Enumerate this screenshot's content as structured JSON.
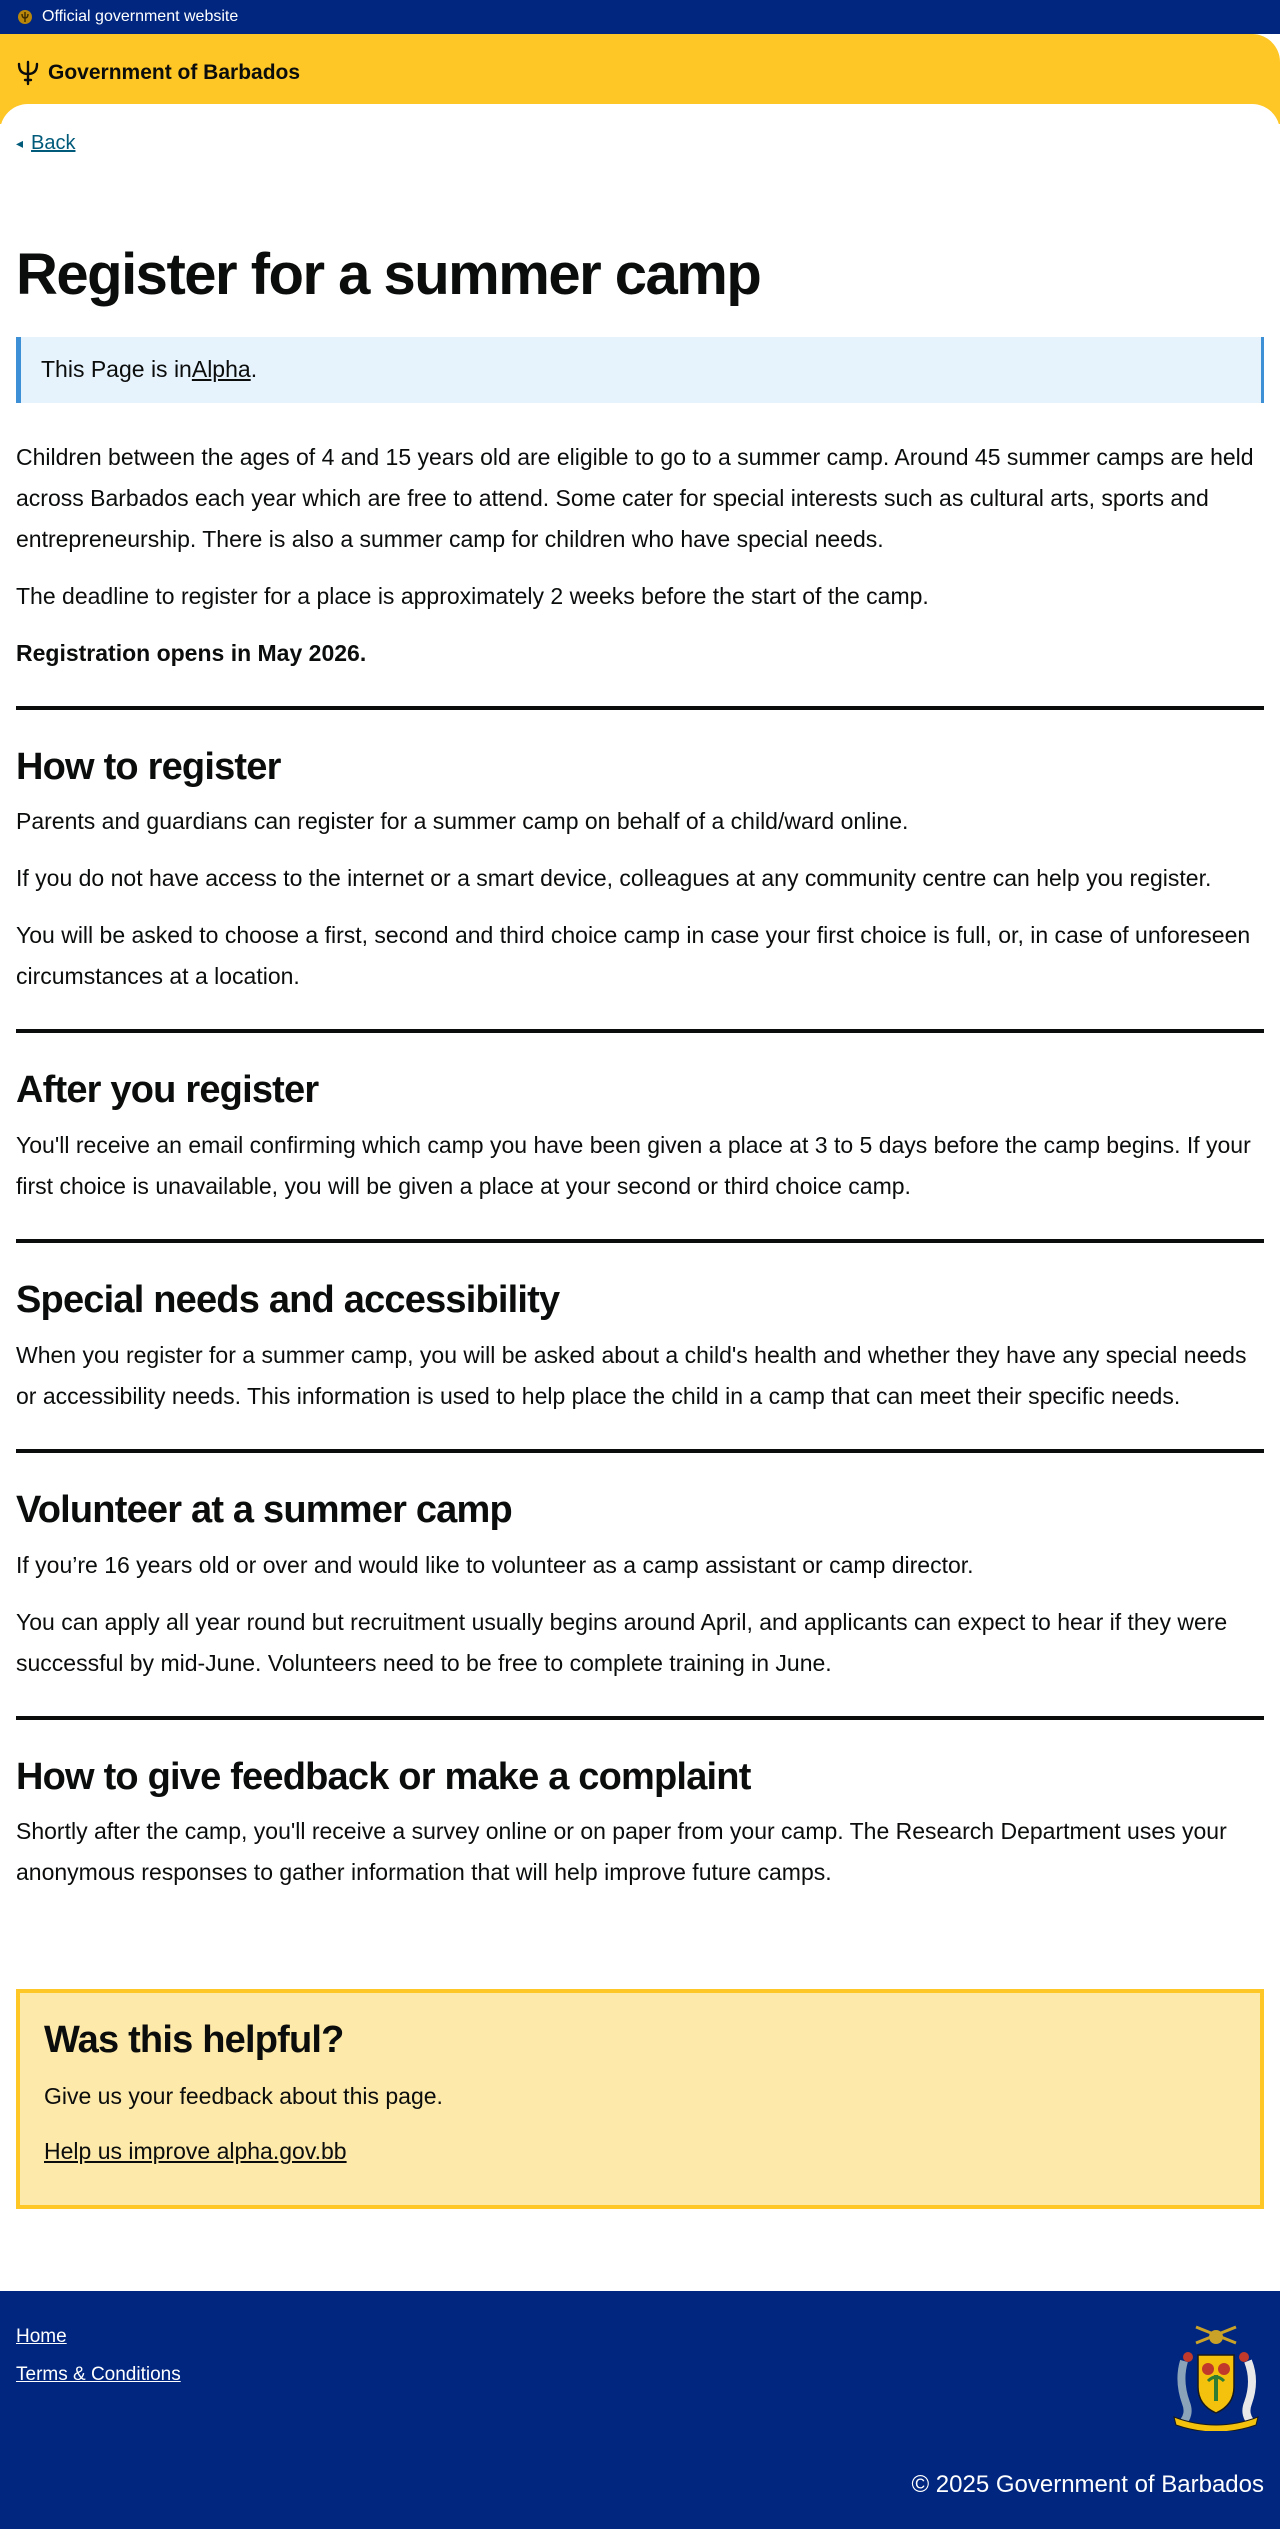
{
  "topbar": {
    "label": "Official government website",
    "flag_icon": "barbados-flag-icon"
  },
  "header": {
    "brand": "Government of Barbados",
    "logo_icon": "trident-icon"
  },
  "nav": {
    "back_label": "Back"
  },
  "page_title": "Register for a summer camp",
  "alpha_banner": {
    "prefix": "This Page is in ",
    "link": "Alpha",
    "suffix": "."
  },
  "intro": {
    "p1": "Children between the ages of 4 and 15 years old are eligible to go to a summer camp. Around 45 summer camps are held across Barbados each year which are free to attend. Some cater for special interests such as cultural arts, sports and entrepreneurship. There is also a summer camp for children who have special needs.",
    "p2": "The deadline to register for a place is approximately 2 weeks before the start of the camp.",
    "p3": "Registration opens in May 2026."
  },
  "sections": {
    "how_to_register": {
      "heading": "How to register",
      "p1": "Parents and guardians can register for a summer camp on behalf of a child/ward online.",
      "p2": "If you do not have access to the internet or a smart device, colleagues at any community centre can help you register.",
      "p3": "You will be asked to choose a first, second and third choice camp in case your first choice is full, or, in case of unforeseen circumstances at a location."
    },
    "after_register": {
      "heading": "After you register",
      "p1": "You'll receive an email confirming which camp you have been given a place at 3 to 5 days before the camp begins. If your first choice is unavailable, you will be given a place at your second or third choice camp."
    },
    "special_needs": {
      "heading": "Special needs and accessibility",
      "p1": "When you register for a summer camp, you will be asked about a child's health and whether they have any special needs or accessibility needs. This information is used to help place the child in a camp that can meet their specific needs."
    },
    "volunteer": {
      "heading": "Volunteer at a summer camp",
      "p1": "If you’re 16 years old or over and would like to volunteer as a camp assistant or camp director.",
      "p2": "You can apply all year round but recruitment usually begins around April, and applicants can expect to hear if they were successful by mid-June. Volunteers need to be free to complete training in June."
    },
    "feedback_complaint": {
      "heading": "How to give feedback or make a complaint",
      "p1": "Shortly after the camp, you'll receive a survey online or on paper from your camp. The Research Department uses your anonymous responses to gather information that will help improve future camps."
    }
  },
  "helpful": {
    "heading": "Was this helpful?",
    "text": "Give us your feedback about this page.",
    "link": "Help us improve alpha.gov.bb"
  },
  "footer": {
    "links": [
      "Home",
      "Terms & Conditions"
    ],
    "copyright": "© 2025 Government of Barbados",
    "crest_icon": "coat-of-arms-icon"
  },
  "colors": {
    "navy": "#00267f",
    "gold": "#ffc726",
    "alpha_bg": "#e6f2fc",
    "alpha_border": "#3d8fd6",
    "helpful_bg": "#fde9a9"
  }
}
